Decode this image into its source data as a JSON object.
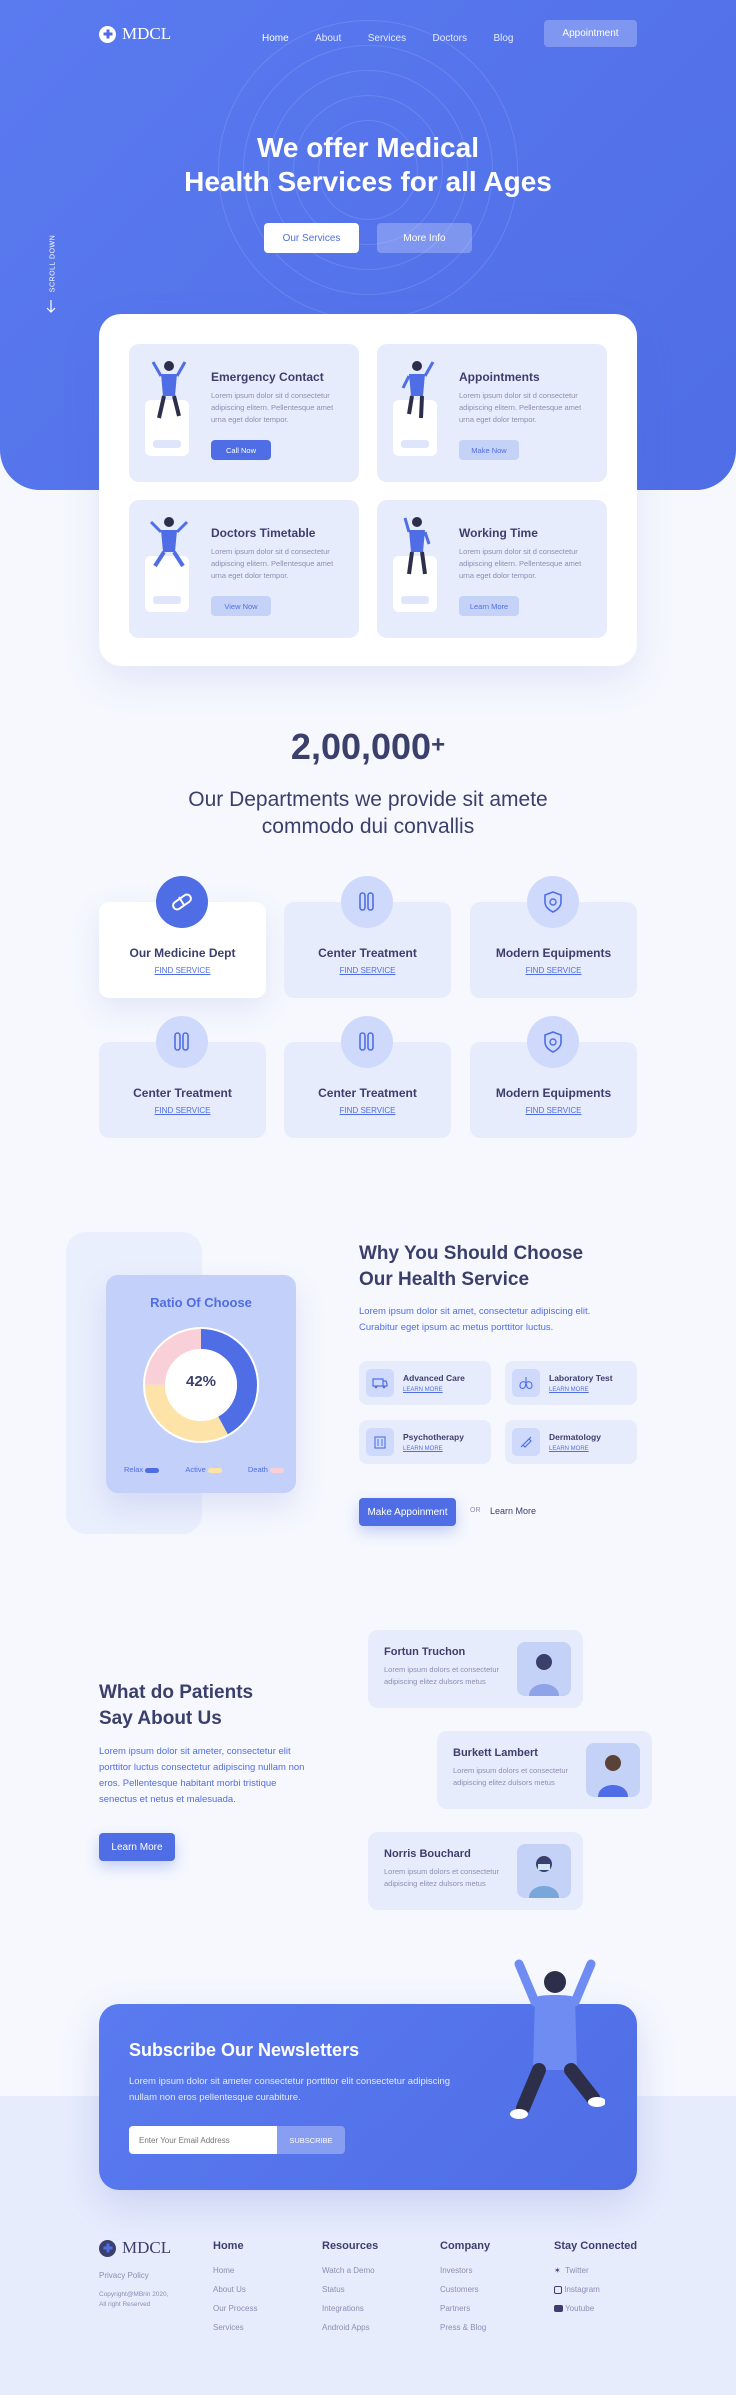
{
  "brand": {
    "name": "MDCL"
  },
  "nav": {
    "items": [
      "Home",
      "About",
      "Services",
      "Doctors",
      "Blog"
    ],
    "cta": "Appointment"
  },
  "hero": {
    "title_line1": "We offer Medical",
    "title_line2": "Health Services for all Ages",
    "primary_btn": "Our Services",
    "secondary_btn": "More Info",
    "scroll_label": "SCROLL DOWN"
  },
  "services": [
    {
      "title": "Emergency Contact",
      "text": "Lorem ipsum dolor sit d consectetur adipiscing elitern. Pellentesque amet urna eget dolor tempor.",
      "button": "Call Now"
    },
    {
      "title": "Appointments",
      "text": "Lorem ipsum dolor sit d consectetur adipiscing elitern. Pellentesque amet urna eget dolor tempor.",
      "button": "Make Now"
    },
    {
      "title": "Doctors Timetable",
      "text": "Lorem ipsum dolor sit d consectetur adipiscing elitern. Pellentesque amet urna eget dolor tempor.",
      "button": "View Now"
    },
    {
      "title": "Working Time",
      "text": "Lorem ipsum dolor sit d consectetur adipiscing elitern. Pellentesque amet urna eget dolor tempor.",
      "button": "Learn More"
    }
  ],
  "stats": {
    "number": "2,00,000",
    "plus": "+",
    "heading_line1": "Our Departments we provide sit amete",
    "heading_line2": "commodo dui convallis"
  },
  "departments": [
    {
      "title": "Our Medicine Dept",
      "link": "FIND SERVICE",
      "icon": "pill-icon"
    },
    {
      "title": "Center Treatment",
      "link": "FIND SERVICE",
      "icon": "test-tube-icon"
    },
    {
      "title": "Modern Equipments",
      "link": "FIND SERVICE",
      "icon": "shield-icon"
    },
    {
      "title": "Center Treatment",
      "link": "FIND SERVICE",
      "icon": "test-tube-icon"
    },
    {
      "title": "Center Treatment",
      "link": "FIND SERVICE",
      "icon": "test-tube-icon"
    },
    {
      "title": "Modern Equipments",
      "link": "FIND SERVICE",
      "icon": "shield-icon"
    }
  ],
  "ratio": {
    "title": "Ratio Of Choose",
    "percent_label": "42%",
    "legend": [
      "Relax",
      "Active",
      "Death"
    ],
    "colors": {
      "relax": "#4f6ee6",
      "active": "#fde3a7",
      "death": "#f9d0d8"
    }
  },
  "chart_data": {
    "type": "pie",
    "title": "Ratio Of Choose",
    "categories": [
      "Relax",
      "Active",
      "Death"
    ],
    "values": [
      42,
      33,
      25
    ],
    "center_label": "42%"
  },
  "why": {
    "title_line1": "Why You Should Choose",
    "title_line2": "Our Health Service",
    "text": "Lorem ipsum dolor sit amet, consectetur adipiscing elit. Curabitur eget ipsum ac metus porttitor luctus.",
    "features": [
      {
        "title": "Advanced Care",
        "link": "LEARN MORE",
        "icon": "ambulance-icon"
      },
      {
        "title": "Laboratory Test",
        "link": "LEARN MORE",
        "icon": "lungs-icon"
      },
      {
        "title": "Psychotherapy",
        "link": "LEARN MORE",
        "icon": "building-icon"
      },
      {
        "title": "Dermatology",
        "link": "LEARN MORE",
        "icon": "syringe-icon"
      }
    ],
    "primary_btn": "Make Appoinment",
    "or": "OR",
    "secondary_link": "Learn More"
  },
  "patients": {
    "title_line1": "What do Patients",
    "title_line2": "Say About Us",
    "text": "Lorem ipsum dolor sit ameter, consectetur elit porttitor luctus consectetur adipiscing nullam non eros. Pellentesque habitant morbi tristique senectus et netus et malesuada.",
    "button": "Learn More",
    "testimonials": [
      {
        "name": "Fortun Truchon",
        "text": "Lorem ipsum dolors et consectetur adipiscing elitez dulsors metus"
      },
      {
        "name": "Burkett Lambert",
        "text": "Lorem ipsum dolors et consectetur adipiscing elitez dulsors metus"
      },
      {
        "name": "Norris Bouchard",
        "text": "Lorem ipsum dolors et consectetur adipiscing elitez dulsors metus"
      }
    ]
  },
  "newsletter": {
    "title": "Subscribe Our Newsletters",
    "text_line1": "Lorem ipsum dolor sit ameter consectetur porttitor elit consectetur adipiscing",
    "text_line2": "nullam non eros pellentesque curabiture.",
    "placeholder": "Enter Your Email Address",
    "button": "SUBSCRIBE"
  },
  "footer": {
    "brand": "MDCL",
    "policy": "Privacy Policy",
    "copyright_line1": "Copyright@MBrin 2020,",
    "copyright_line2": "All right Reserved",
    "columns": [
      {
        "title": "Home",
        "items": [
          "Home",
          "About Us",
          "Our Process",
          "Services"
        ]
      },
      {
        "title": "Resources",
        "items": [
          "Watch a Demo",
          "Status",
          "Integrations",
          "Android Apps"
        ]
      },
      {
        "title": "Company",
        "items": [
          "Investors",
          "Customers",
          "Partners",
          "Press & Blog"
        ]
      }
    ],
    "social_title": "Stay Connected",
    "social": [
      {
        "label": "Twitter",
        "icon": "twitter-icon"
      },
      {
        "label": "Instagram",
        "icon": "instagram-icon"
      },
      {
        "label": "Youtube",
        "icon": "youtube-icon"
      }
    ]
  }
}
